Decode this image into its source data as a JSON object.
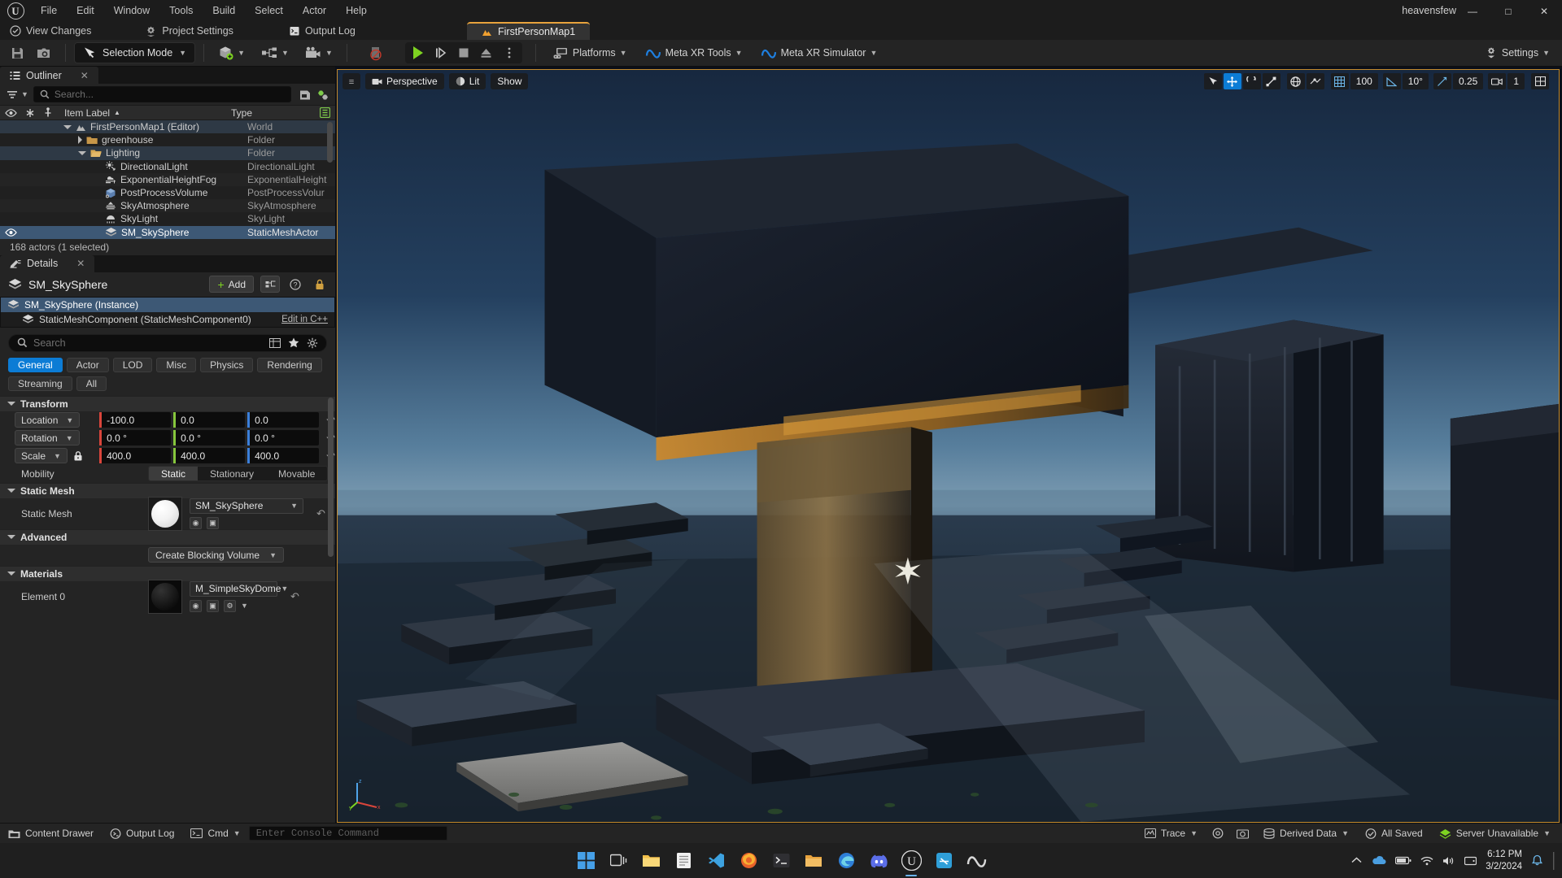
{
  "titlebar": {
    "logo": "unreal-logo",
    "menus": [
      "File",
      "Edit",
      "Window",
      "Tools",
      "Build",
      "Select",
      "Actor",
      "Help"
    ],
    "user": "heavensfew",
    "window_buttons": [
      "minimize",
      "maximize",
      "close"
    ]
  },
  "tabrow": {
    "source_control": "View Changes",
    "project_settings": "Project Settings",
    "output_log": "Output Log",
    "document_tab": "FirstPersonMap1"
  },
  "toolbar": {
    "save_icon": "save-icon",
    "snapshot_icon": "snapshot-icon",
    "mode_label": "Selection Mode",
    "add_label": "add-actor",
    "blueprint_label": "blueprints",
    "cinematics_label": "cinematics",
    "play_label": "Play",
    "skip_label": "Skip",
    "stop_label": "Stop",
    "eject_label": "Eject",
    "options_label": "Play Options",
    "platforms": "Platforms",
    "meta_xr_tools": "Meta XR Tools",
    "meta_xr_simulator": "Meta XR Simulator",
    "settings": "Settings"
  },
  "outliner": {
    "tab_title": "Outliner",
    "search_placeholder": "Search...",
    "columns": {
      "label": "Item Label",
      "type": "Type"
    },
    "rows": [
      {
        "label": "FirstPersonMap1 (Editor)",
        "type": "World",
        "indent": 0,
        "icon": "world-icon",
        "expander": "down",
        "state": "hl"
      },
      {
        "label": "greenhouse",
        "type": "Folder",
        "indent": 1,
        "icon": "folder-icon",
        "expander": "right",
        "state": "alt"
      },
      {
        "label": "Lighting",
        "type": "Folder",
        "indent": 1,
        "icon": "folder-open-icon",
        "expander": "down",
        "state": "hl"
      },
      {
        "label": "DirectionalLight",
        "type": "DirectionalLight",
        "indent": 2,
        "icon": "directional-light-icon",
        "expander": "none",
        "state": "alt"
      },
      {
        "label": "ExponentialHeightFog",
        "type": "ExponentialHeight",
        "indent": 2,
        "icon": "fog-icon",
        "expander": "none",
        "state": "none"
      },
      {
        "label": "PostProcessVolume",
        "type": "PostProcessVolur",
        "indent": 2,
        "icon": "volume-icon",
        "expander": "none",
        "state": "alt"
      },
      {
        "label": "SkyAtmosphere",
        "type": "SkyAtmosphere",
        "indent": 2,
        "icon": "sky-atmosphere-icon",
        "expander": "none",
        "state": "none"
      },
      {
        "label": "SkyLight",
        "type": "SkyLight",
        "indent": 2,
        "icon": "sky-light-icon",
        "expander": "none",
        "state": "alt"
      },
      {
        "label": "SM_SkySphere",
        "type": "StaticMeshActor",
        "indent": 2,
        "icon": "static-mesh-icon",
        "expander": "none",
        "state": "sel"
      }
    ],
    "footer": "168 actors (1 selected)"
  },
  "details": {
    "tab_title": "Details",
    "actor_name": "SM_SkySphere",
    "add_label": "Add",
    "components": [
      {
        "label": "SM_SkySphere (Instance)",
        "indent": 0,
        "selected": true,
        "link": ""
      },
      {
        "label": "StaticMeshComponent (StaticMeshComponent0)",
        "indent": 1,
        "selected": false,
        "link": "Edit in C++"
      }
    ],
    "search_placeholder": "Search",
    "category_tabs": [
      {
        "label": "General",
        "active": true
      },
      {
        "label": "Actor",
        "active": false
      },
      {
        "label": "LOD",
        "active": false
      },
      {
        "label": "Misc",
        "active": false
      },
      {
        "label": "Physics",
        "active": false
      },
      {
        "label": "Rendering",
        "active": false
      },
      {
        "label": "Streaming",
        "active": false
      },
      {
        "label": "All",
        "active": false
      }
    ],
    "transform": {
      "section": "Transform",
      "location": {
        "label": "Location",
        "x": "-100.0",
        "y": "0.0",
        "z": "0.0"
      },
      "rotation": {
        "label": "Rotation",
        "x": "0.0 °",
        "y": "0.0 °",
        "z": "0.0 °"
      },
      "scale": {
        "label": "Scale",
        "x": "400.0",
        "y": "400.0",
        "z": "400.0",
        "locked": true
      },
      "mobility": {
        "label": "Mobility",
        "options": [
          "Static",
          "Stationary",
          "Movable"
        ],
        "selected": "Static"
      }
    },
    "static_mesh": {
      "section": "Static Mesh",
      "label": "Static Mesh",
      "value": "SM_SkySphere"
    },
    "advanced": {
      "section": "Advanced",
      "button": "Create Blocking Volume"
    },
    "materials": {
      "section": "Materials",
      "label": "Element 0",
      "value": "M_SimpleSkyDome"
    }
  },
  "viewport": {
    "menu_icon": "hamburger-icon",
    "perspective": "Perspective",
    "view_mode": "Lit",
    "show": "Show",
    "tools": {
      "select_icon": "cursor-select-icon",
      "translate_icon": "translate-gizmo-icon",
      "rotate_icon": "rotate-gizmo-icon",
      "scale_icon": "scale-gizmo-icon",
      "world_icon": "world-space-icon",
      "surface_snap_icon": "surface-snap-icon"
    },
    "grid_snap": "100",
    "angle_snap": "10°",
    "scale_snap": "0.25",
    "camera_speed": "1",
    "layouts_icon": "viewport-layouts-icon"
  },
  "statusbar": {
    "content_drawer": "Content Drawer",
    "output_log": "Output Log",
    "cmd_label": "Cmd",
    "console_placeholder": "Enter Console Command",
    "trace": "Trace",
    "derived_data": "Derived Data",
    "all_saved": "All Saved",
    "server": "Server Unavailable"
  },
  "taskbar": {
    "apps": [
      "start-icon",
      "task-view-icon",
      "file-explorer-icon",
      "notepad-icon",
      "vscode-icon",
      "firefox-icon",
      "terminal-icon",
      "folder-icon",
      "edge-icon",
      "discord-icon",
      "unreal-engine-icon",
      "blender-icon",
      "meta-icon"
    ],
    "tray": {
      "chevron": "show-hidden-icon",
      "battery": "battery-icon",
      "wifi": "wifi-icon",
      "volume": "volume-icon",
      "drive": "drive-icon"
    },
    "time": "6:12 PM",
    "date": "3/2/2024",
    "notification": "notification-icon"
  }
}
